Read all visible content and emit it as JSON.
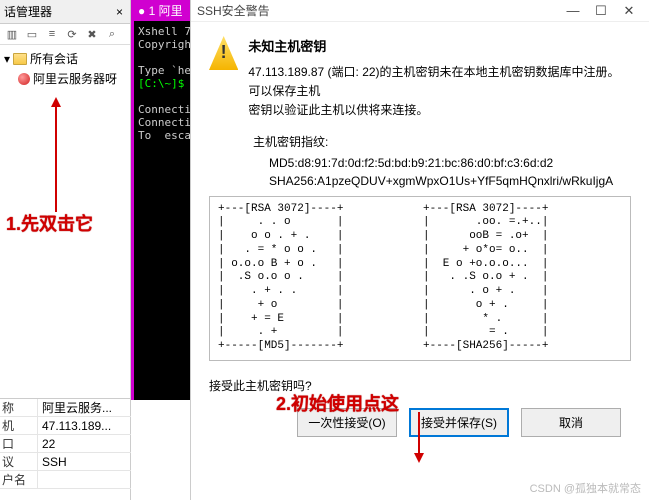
{
  "session_mgr": {
    "title": "话管理器",
    "close": "×",
    "all_sessions": "所有会话",
    "server_name": "阿里云服务器呀"
  },
  "terminal": {
    "tab": "● 1 阿里",
    "line1": "Xshell 7",
    "line2": "Copyright",
    "line3": "Type `he",
    "prompt": "[C:\\~]$",
    "line4": "Connecti",
    "line5": "Connecti",
    "line6": "To  escap"
  },
  "dialog": {
    "win_title": "SSH安全警告",
    "heading": "未知主机密钥",
    "message1": "47.113.189.87 (端口: 22)的主机密钥未在本地主机密钥数据库中注册。可以保存主机",
    "message2": "密钥以验证此主机以供将来连接。",
    "fingerprint_label": "主机密钥指纹:",
    "md5": "MD5:d8:91:7d:0d:f2:5d:bd:b9:21:bc:86:d0:bf:c3:6d:d2",
    "sha256": "SHA256:A1pzeQDUV+xgmWpxO1Us+YfF5qmHQnxlri/wRkuIjgA",
    "ascii_left": "+---[RSA 3072]----+\n|     . . o       |\n|    o o . + .    |\n|   . = * o o .   |\n| o.o.o B + o .   |\n|  .S o.o o .     |\n|    . + . .      |\n|     + o         |\n|    + = E        |\n|     . +         |\n+-----[MD5]-------+",
    "ascii_right": "+---[RSA 3072]----+\n|       .oo. =.+..|\n|      ooB = .o+  |\n|     + o*o= o..  |\n|  E o +o.o.o...  |\n|   . .S o.o + .  |\n|      . o + .    |\n|       o + .     |\n|        * .      |\n|         = .     |\n+----[SHA256]-----+",
    "prompt_question": "接受此主机密钥吗?",
    "btn_once": "一次性接受(O)",
    "btn_save": "接受并保存(S)",
    "btn_cancel": "取消"
  },
  "annotations": {
    "step1": "1.先双击它",
    "step2": "2.初始使用点这"
  },
  "props": {
    "rows": [
      {
        "k": "称",
        "v": "阿里云服务..."
      },
      {
        "k": "机",
        "v": "47.113.189..."
      },
      {
        "k": "口",
        "v": "22"
      },
      {
        "k": "议",
        "v": "SSH"
      },
      {
        "k": "户名",
        "v": ""
      }
    ]
  },
  "watermark": "CSDN @孤独本就常态"
}
